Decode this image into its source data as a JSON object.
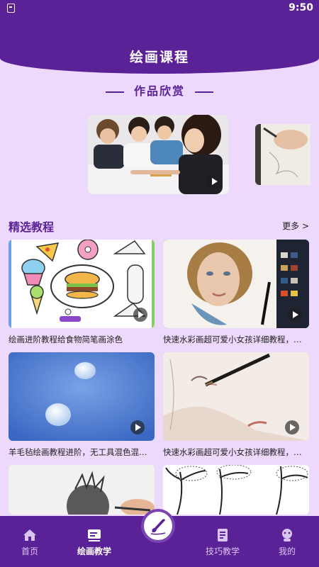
{
  "status_bar": {
    "time": "9:50"
  },
  "header": {
    "title": "绘画课程"
  },
  "showcase": {
    "title": "作品欣赏"
  },
  "featured": {
    "title": "精选教程",
    "more_label": "更多 >",
    "items": [
      {
        "caption": "绘画进阶教程给食物简笔画涂色"
      },
      {
        "caption": "快速水彩画超可爱小女孩详细教程，几步画出"
      },
      {
        "caption": "羊毛毡绘画教程进阶，无工具混色混毛技法"
      },
      {
        "caption": "快速水彩画超可爱小女孩详细教程，几步画出"
      }
    ]
  },
  "bottom_nav": {
    "tabs": [
      {
        "label": "首页",
        "icon": "home-icon"
      },
      {
        "label": "绘画教学",
        "icon": "video-lesson-icon"
      },
      {
        "label": "技巧教学",
        "icon": "book-icon"
      },
      {
        "label": "我的",
        "icon": "profile-icon"
      }
    ],
    "center_icon": "brush-icon",
    "active_tab": "绘画教学"
  },
  "colors": {
    "brand": "#5b2196",
    "background": "#ecd9fb"
  }
}
